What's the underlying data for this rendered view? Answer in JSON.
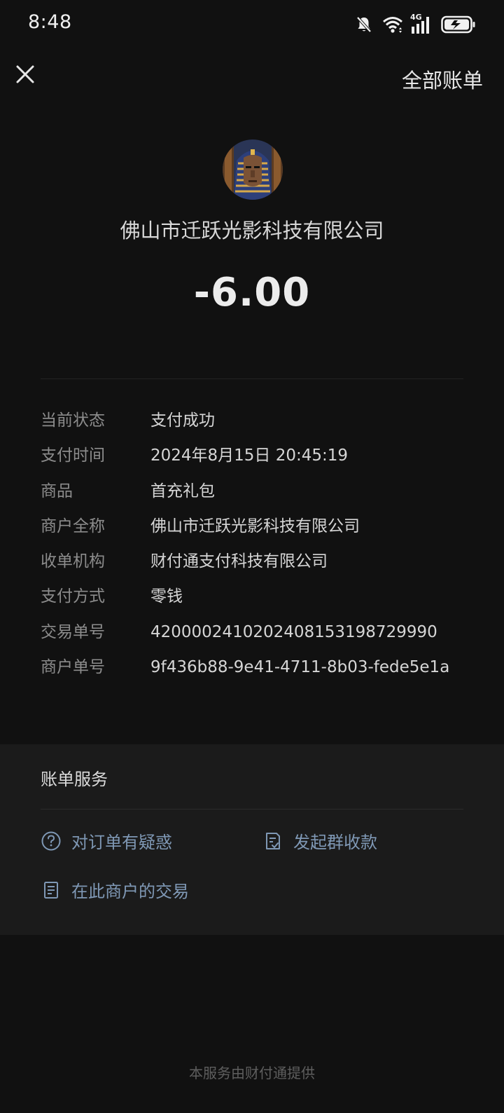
{
  "status_bar": {
    "time": "8:48",
    "network_label": "4G",
    "icons": [
      "bell-muted-icon",
      "wifi-icon",
      "signal-icon",
      "battery-icon"
    ]
  },
  "nav": {
    "close_icon": "close-icon",
    "all_bills_label": "全部账单"
  },
  "merchant": {
    "name": "佛山市迁跃光影科技有限公司",
    "avatar_icon": "merchant-avatar"
  },
  "amount": "-6.00",
  "details": [
    {
      "label": "当前状态",
      "value": "支付成功"
    },
    {
      "label": "支付时间",
      "value": "2024年8月15日 20:45:19"
    },
    {
      "label": "商品",
      "value": "首充礼包"
    },
    {
      "label": "商户全称",
      "value": "佛山市迁跃光影科技有限公司"
    },
    {
      "label": "收单机构",
      "value": "财付通支付科技有限公司"
    },
    {
      "label": "支付方式",
      "value": "零钱"
    },
    {
      "label": "交易单号",
      "value": "4200002410202408153198729990"
    },
    {
      "label": "商户单号",
      "value": "9f436b88-9e41-4711-8b03-fede5e1a"
    }
  ],
  "service": {
    "title": "账单服务",
    "items": [
      {
        "label": "对订单有疑惑",
        "icon": "question-circle-icon"
      },
      {
        "label": "发起群收款",
        "icon": "group-collect-icon"
      },
      {
        "label": "在此商户的交易",
        "icon": "document-list-icon"
      }
    ]
  },
  "footer": "本服务由财付通提供",
  "colors": {
    "background": "#111111",
    "card": "#1b1b1b",
    "link": "#7f98b5",
    "label": "#8c8c8c"
  }
}
